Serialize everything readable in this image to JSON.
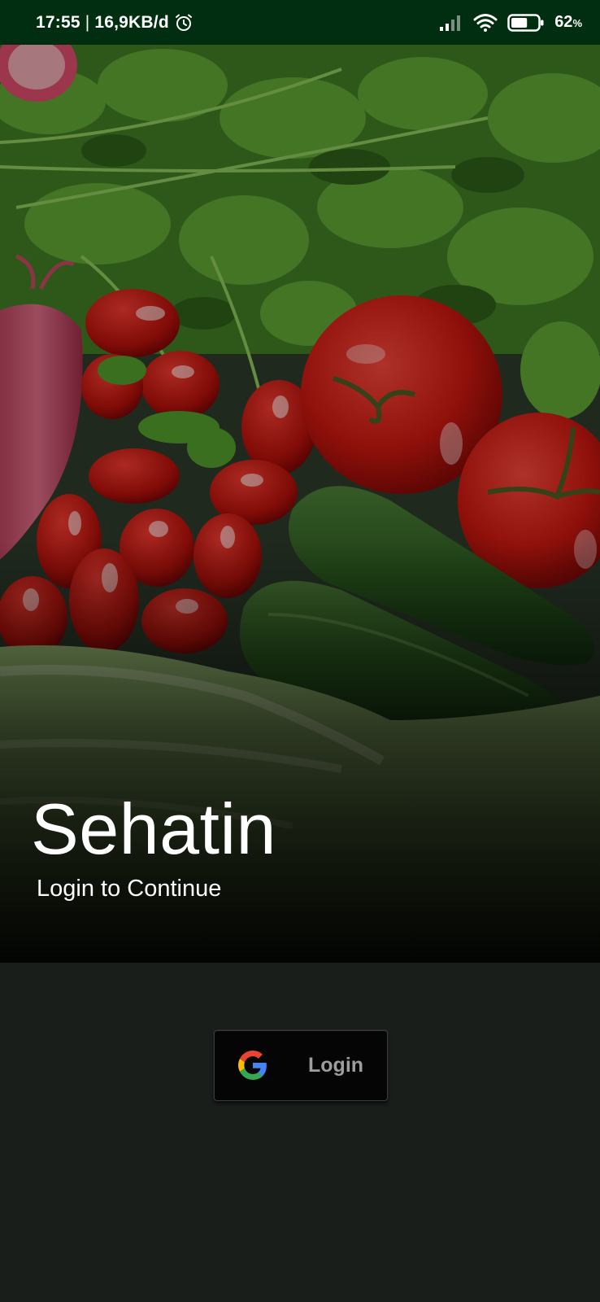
{
  "status_bar": {
    "time": "17:55",
    "separator": "|",
    "data_rate": "16,9KB/d",
    "battery_percent": "62",
    "battery_unit": "%",
    "battery_level": 0.62,
    "icons": [
      "alarm-icon",
      "signal-icon",
      "wifi-icon",
      "battery-icon"
    ]
  },
  "hero": {
    "title": "Sehatin",
    "subtitle": "Login to Continue"
  },
  "login": {
    "label": "Login",
    "icon": "google-icon"
  },
  "colors": {
    "status_bar_bg": "#012e10",
    "screen_bg": "#1a1e1b",
    "button_bg": "#050505",
    "button_text": "#9e9e9e"
  }
}
